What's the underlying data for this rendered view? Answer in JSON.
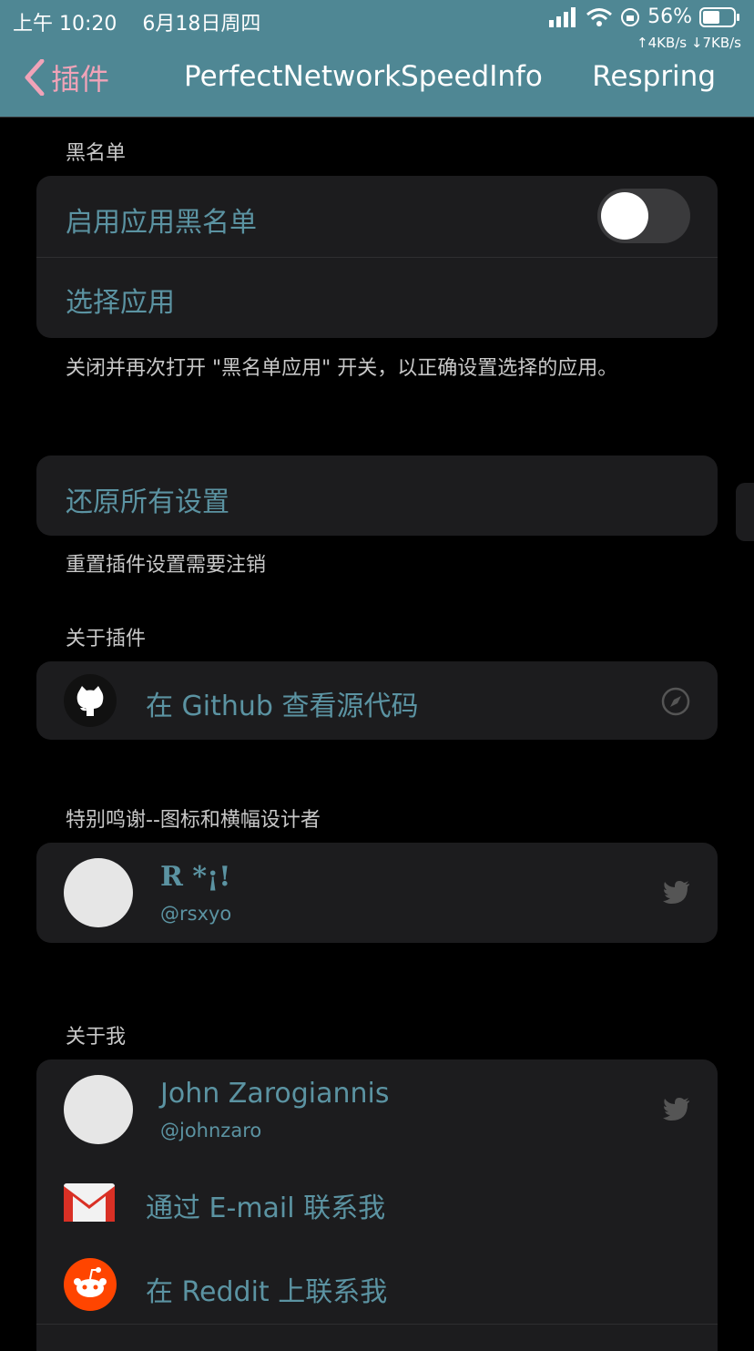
{
  "status": {
    "time": "上午 10:20",
    "date": "6月18日周四",
    "battery": "56%",
    "speed": "↑4KB/s ↓7KB/s"
  },
  "nav": {
    "back_label": "插件",
    "title": "PerfectNetworkSpeedInfo",
    "respring": "Respring"
  },
  "blacklist": {
    "header": "黑名单",
    "enable_label": "启用应用黑名单",
    "enabled": false,
    "select_label": "选择应用",
    "footer": "关闭并再次打开 \"黑名单应用\" 开关，以正确设置选择的应用。"
  },
  "reset": {
    "label": "还原所有设置",
    "footer": "重置插件设置需要注销"
  },
  "about_plugin": {
    "header": "关于插件",
    "github_label": "在 Github 查看源代码"
  },
  "thanks": {
    "header": "特别鸣谢--图标和横幅设计者",
    "name": "R *¡!",
    "handle": "@rsxyo"
  },
  "about_me": {
    "header": "关于我",
    "name": "John Zarogiannis",
    "handle": "@johnzaro",
    "email_label": "通过 E-mail 联系我",
    "reddit_label": "在 Reddit 上联系我"
  },
  "colors": {
    "navbar": "#4f8794",
    "accent_text": "#5b93a2",
    "back": "#f0a3b8"
  }
}
